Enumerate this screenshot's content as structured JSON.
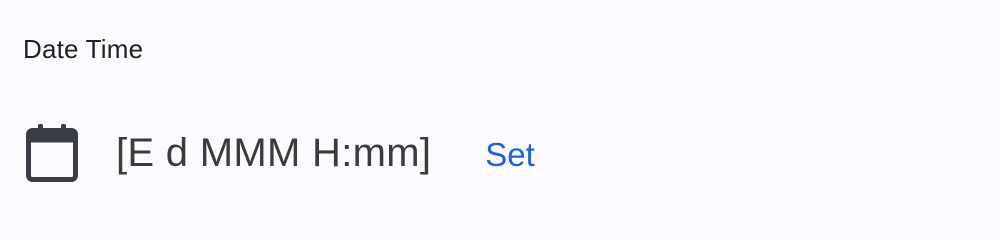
{
  "field": {
    "label": "Date Time",
    "value": "[E d MMM H:mm]",
    "icon": "calendar-icon",
    "action_label": "Set",
    "accent_color": "#1f63d6"
  }
}
